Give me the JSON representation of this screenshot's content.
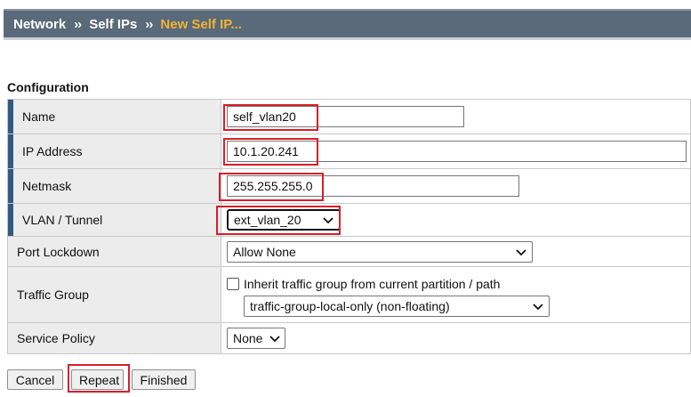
{
  "breadcrumb": {
    "items": [
      "Network",
      "Self IPs",
      "New Self IP..."
    ],
    "separator": "››"
  },
  "section": {
    "title": "Configuration"
  },
  "fields": {
    "name": {
      "label": "Name",
      "value": "self_vlan20"
    },
    "ip_address": {
      "label": "IP Address",
      "value": "10.1.20.241"
    },
    "netmask": {
      "label": "Netmask",
      "value": "255.255.255.0"
    },
    "vlan": {
      "label": "VLAN / Tunnel",
      "value": "ext_vlan_20"
    },
    "port_lockdown": {
      "label": "Port Lockdown",
      "value": "Allow None"
    },
    "traffic_group": {
      "label": "Traffic Group",
      "inherit_label": "Inherit traffic group from current partition / path",
      "inherit_checked": false,
      "value": "traffic-group-local-only (non-floating)"
    },
    "service_policy": {
      "label": "Service Policy",
      "value": "None"
    }
  },
  "buttons": {
    "cancel": "Cancel",
    "repeat": "Repeat",
    "finished": "Finished"
  },
  "colors": {
    "header_bg": "#5a6a7a",
    "breadcrumb_current": "#f2b233",
    "required_marker": "#305a85",
    "highlight": "#d81e2a"
  }
}
